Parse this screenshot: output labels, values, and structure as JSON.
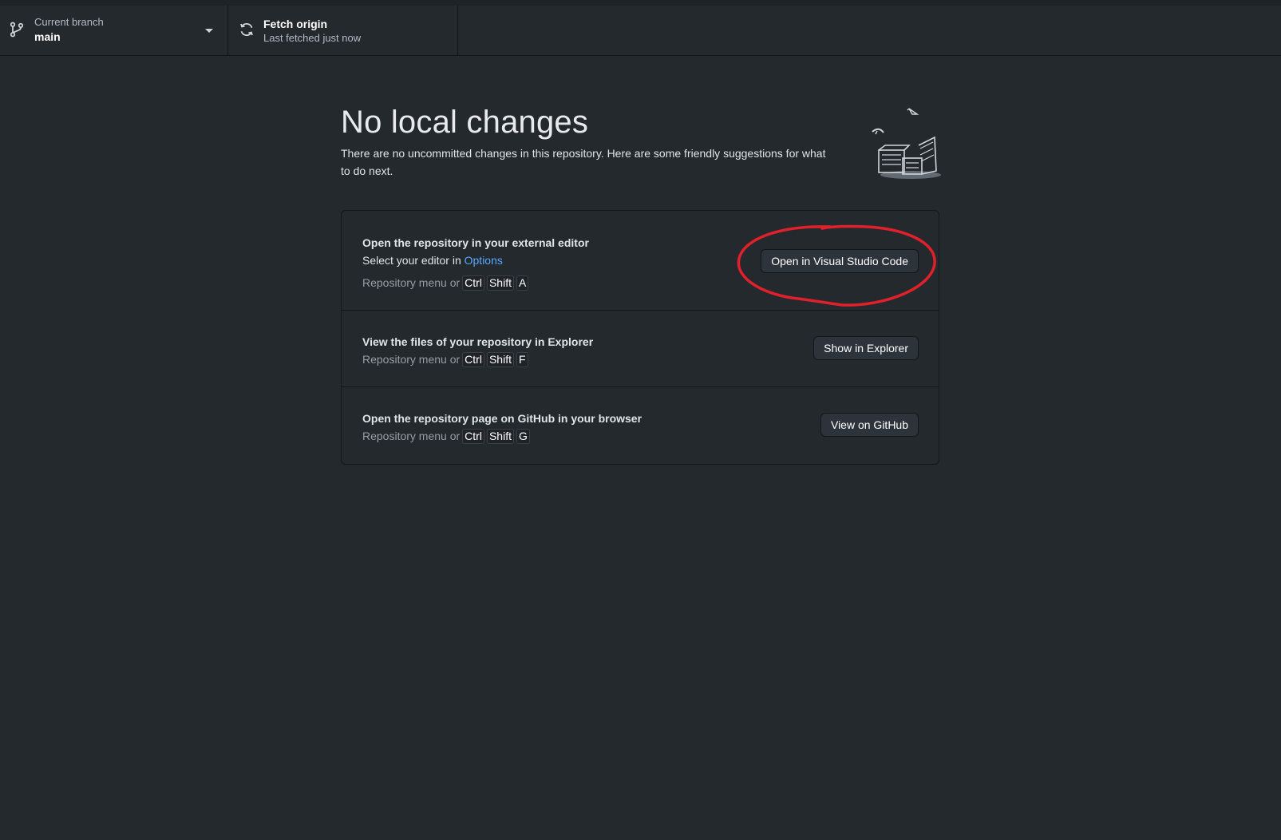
{
  "toolbar": {
    "branch": {
      "label": "Current branch",
      "value": "main",
      "icon": "git-branch-icon"
    },
    "fetch": {
      "label": "Fetch origin",
      "sublabel": "Last fetched just now",
      "icon": "sync-icon"
    }
  },
  "main": {
    "title": "No local changes",
    "subtitle": "There are no uncommitted changes in this repository. Here are some friendly suggestions for what to do next."
  },
  "suggestions": [
    {
      "title": "Open the repository in your external editor",
      "desc_prefix": "Select your editor in ",
      "desc_link": "Options",
      "shortcut_prefix": "Repository menu or",
      "keys": [
        "Ctrl",
        "Shift",
        "A"
      ],
      "button": "Open in Visual Studio Code"
    },
    {
      "title": "View the files of your repository in Explorer",
      "shortcut_prefix": "Repository menu or",
      "keys": [
        "Ctrl",
        "Shift",
        "F"
      ],
      "button": "Show in Explorer"
    },
    {
      "title": "Open the repository page on GitHub in your browser",
      "shortcut_prefix": "Repository menu or",
      "keys": [
        "Ctrl",
        "Shift",
        "G"
      ],
      "button": "View on GitHub"
    }
  ],
  "colors": {
    "background": "#24292e",
    "border": "#141618",
    "link": "#58a6ff",
    "annotation": "#e0202a"
  }
}
